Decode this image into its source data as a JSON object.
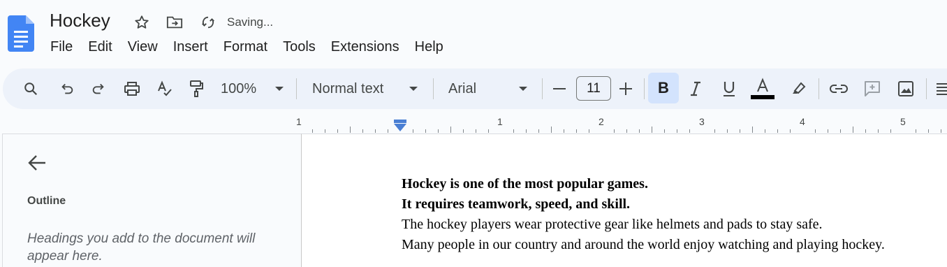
{
  "document": {
    "title": "Hockey",
    "status": "Saving..."
  },
  "menu": [
    "File",
    "Edit",
    "View",
    "Insert",
    "Format",
    "Tools",
    "Extensions",
    "Help"
  ],
  "toolbar": {
    "zoom": "100%",
    "style": "Normal text",
    "font": "Arial",
    "font_size": "11",
    "bold_label": "B"
  },
  "ruler": {
    "labels": [
      "1",
      "1",
      "2",
      "3",
      "4",
      "5"
    ]
  },
  "outline": {
    "label": "Outline",
    "hint": "Headings you add to the document will appear here."
  },
  "content": {
    "lines": [
      "Hockey is one of the most popular games.",
      "It requires teamwork, speed, and skill.",
      "The hockey players wear protective gear like helmets and pads to stay safe.",
      "Many people in our country and around the world enjoy watching and playing hockey."
    ]
  },
  "colors": {
    "accent": "#4285f4",
    "toolbar_bg": "#edf2fa",
    "bold_active": "#d3e3fd"
  }
}
